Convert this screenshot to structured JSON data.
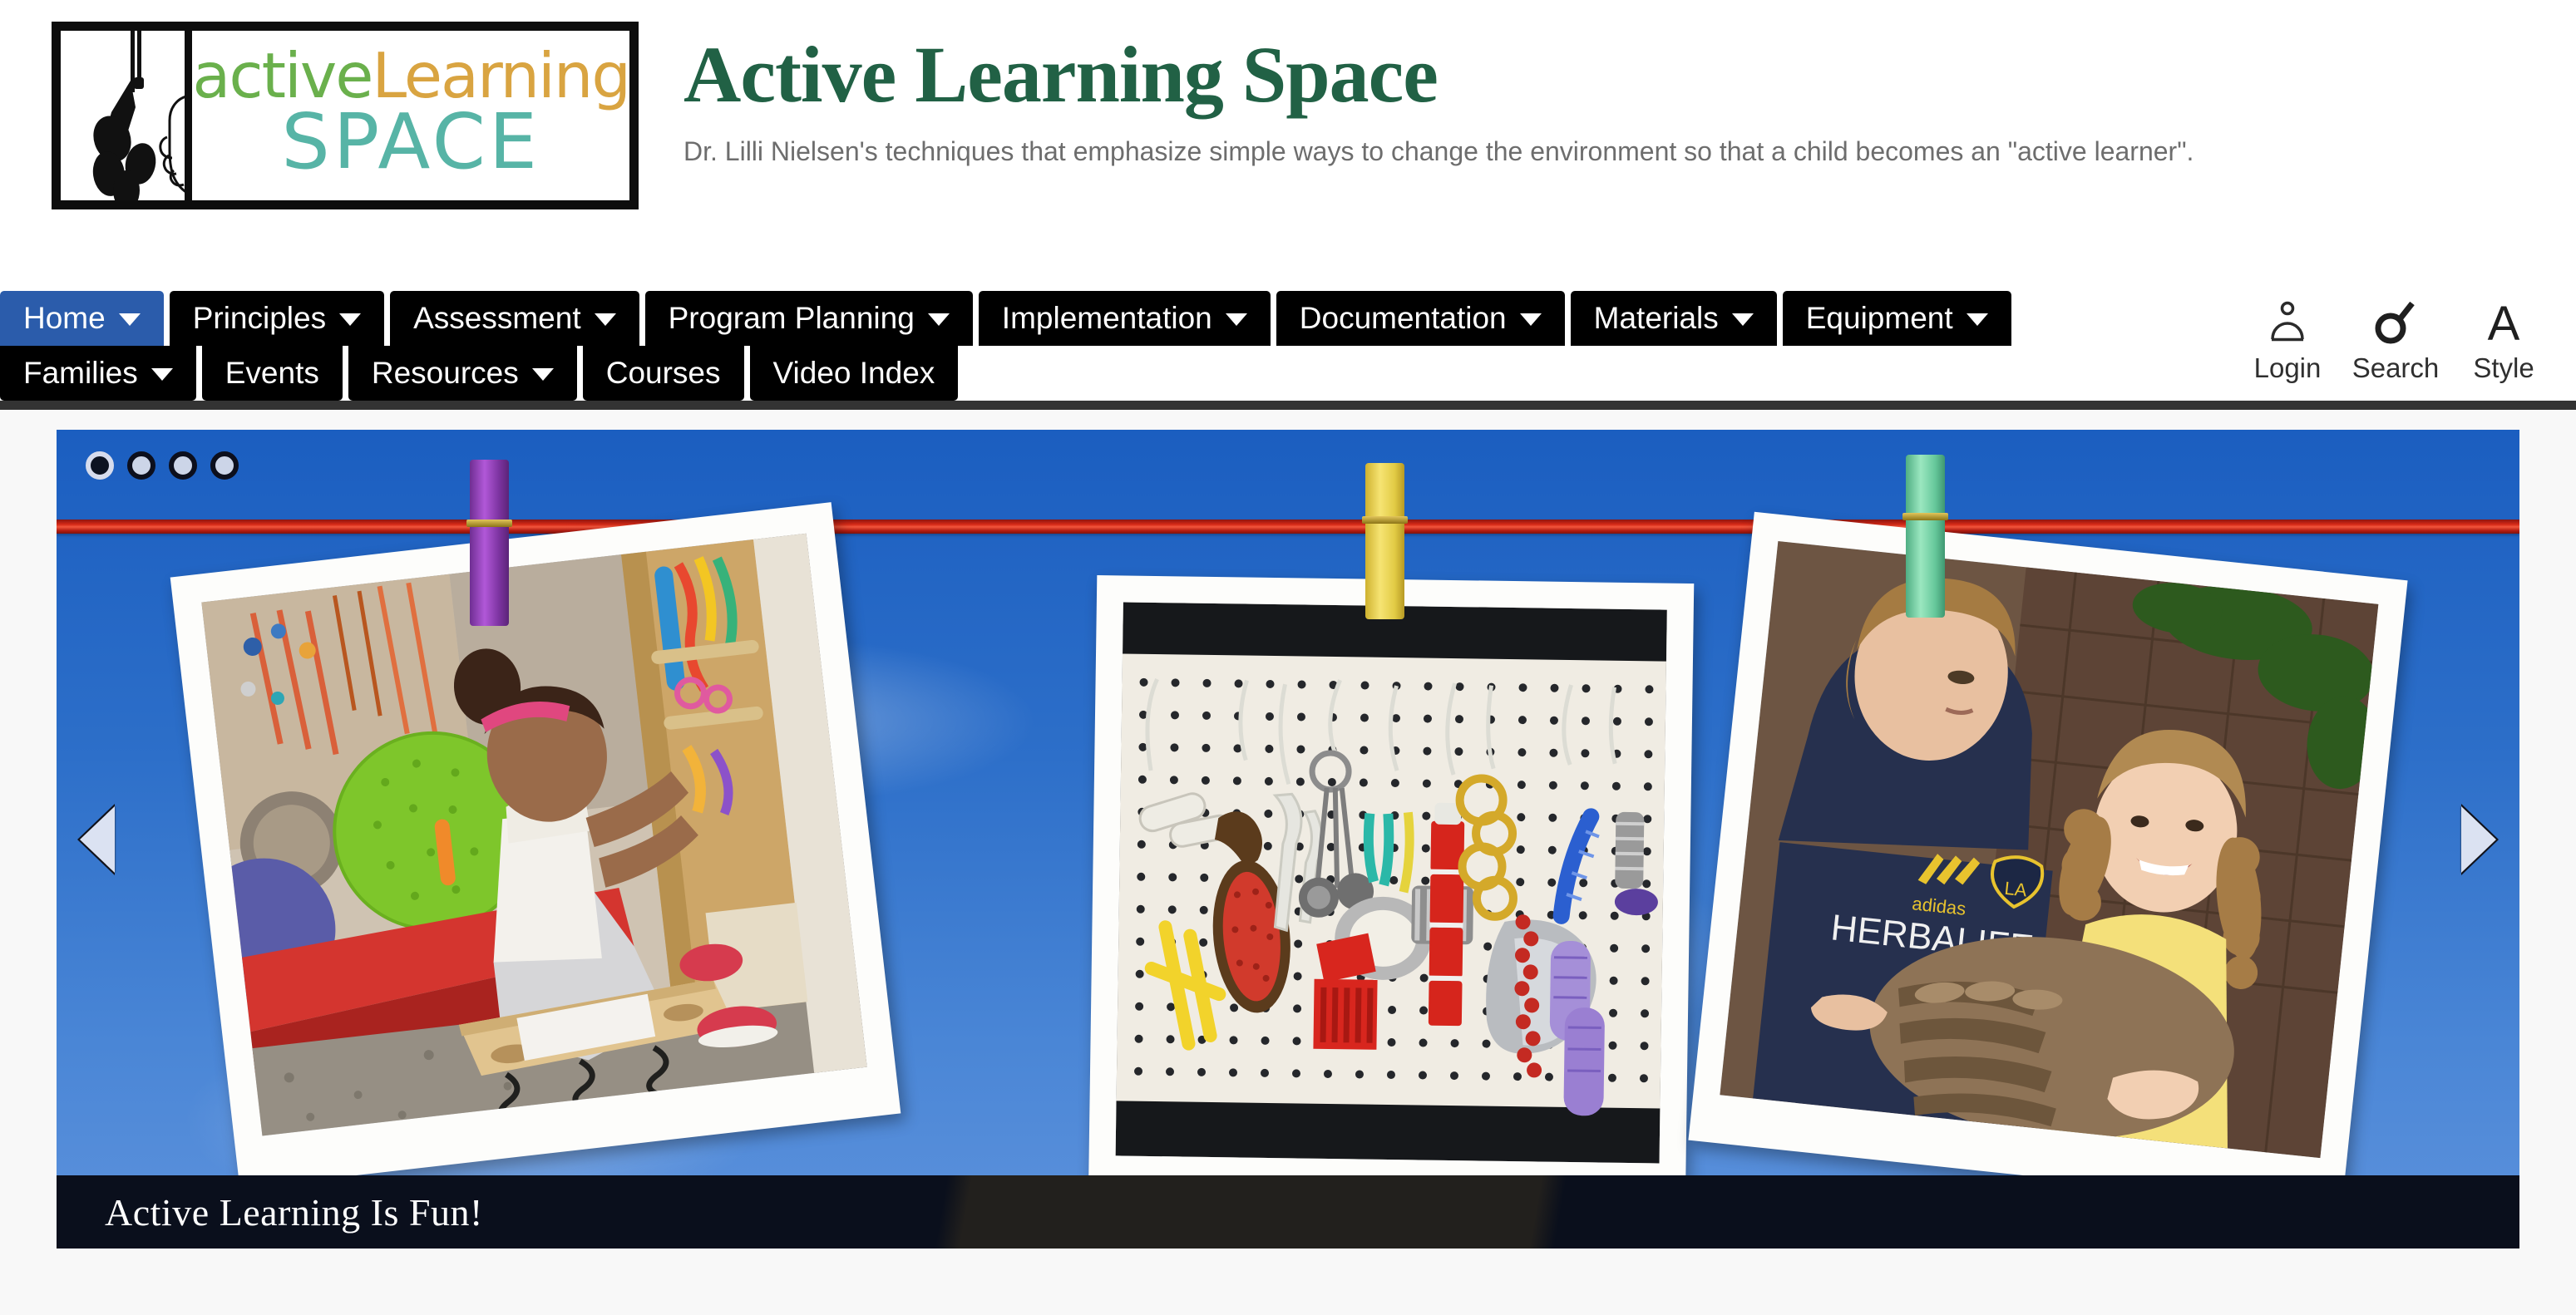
{
  "header": {
    "logo": {
      "alt": "Active Learning Space logo",
      "word_active": "active",
      "word_learning": "Learning",
      "word_space": "SPACE"
    },
    "title": "Active Learning Space",
    "tagline": "Dr. Lilli Nielsen's techniques that emphasize simple ways to change the environment so that a child becomes an \"active learner\"."
  },
  "nav": {
    "row1": [
      {
        "label": "Home",
        "has_dropdown": true,
        "active": true
      },
      {
        "label": "Principles",
        "has_dropdown": true,
        "active": false
      },
      {
        "label": "Assessment",
        "has_dropdown": true,
        "active": false
      },
      {
        "label": "Program Planning",
        "has_dropdown": true,
        "active": false
      },
      {
        "label": "Implementation",
        "has_dropdown": true,
        "active": false
      },
      {
        "label": "Documentation",
        "has_dropdown": true,
        "active": false
      },
      {
        "label": "Materials",
        "has_dropdown": true,
        "active": false
      },
      {
        "label": "Equipment",
        "has_dropdown": true,
        "active": false
      }
    ],
    "row2": [
      {
        "label": "Families",
        "has_dropdown": true,
        "active": false
      },
      {
        "label": "Events",
        "has_dropdown": false,
        "active": false
      },
      {
        "label": "Resources",
        "has_dropdown": true,
        "active": false
      },
      {
        "label": "Courses",
        "has_dropdown": false,
        "active": false
      },
      {
        "label": "Video Index",
        "has_dropdown": false,
        "active": false
      }
    ],
    "utility": [
      {
        "label": "Login",
        "icon": "user-icon"
      },
      {
        "label": "Search",
        "icon": "search-icon"
      },
      {
        "label": "Style",
        "icon": "letter-a-icon"
      }
    ]
  },
  "carousel": {
    "caption": "Active Learning Is Fun!",
    "prev_label": "Previous slide",
    "next_label": "Next slide",
    "slide_count": 4,
    "active_slide": 1,
    "dots": [
      "1",
      "2",
      "3",
      "4"
    ],
    "slides": [
      {
        "alt": "Child seated on a wooden bench exploring hanging objects beside a green spiky ball and red mat",
        "clip_color": "#8e3fb0"
      },
      {
        "alt": "White pegboard with hanging everyday objects: yellow pegs, hairbrush, measuring spoons, red brush, gold rings, red beads, metal scoop, purple rollers",
        "clip_color": "#e8d243"
      },
      {
        "alt": "Woman in navy Herbalife LA Galaxy shirt with smiling girl in yellow holding a large brown bird",
        "clip_color": "#74d2a2"
      }
    ]
  },
  "colors": {
    "brand_green": "#216145",
    "nav_active_blue": "#2b5cab",
    "nav_black": "#000000",
    "sky_blue": "#2d6fc9",
    "clothesline_red": "#d52a17",
    "logo_green": "#6ab04c",
    "logo_gold": "#d9a441",
    "logo_teal": "#57b4a6"
  }
}
